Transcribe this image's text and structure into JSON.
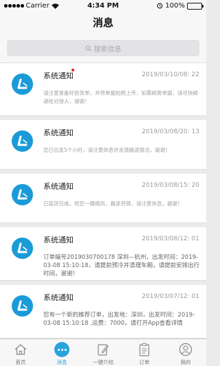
{
  "status_bar": {
    "carrier": "Carrier",
    "time": "4:34 PM",
    "battery": "100%"
  },
  "nav": {
    "title": "消息"
  },
  "search": {
    "placeholder": "搜索信息"
  },
  "messages": [
    {
      "title": "系统通知",
      "time": "2019/03/10/08: 22",
      "unread": true,
      "body": "请注意准备好验货单，并将单据拍照上传，如需邮寄单据，请尽快邮递给对接人，谢谢！"
    },
    {
      "title": "系统通知",
      "time": "2019/03/08/20: 13",
      "unread": false,
      "body": "您已出发5个小时，请注意休息并反馈路途情况，谢谢！"
    },
    {
      "title": "系统通知",
      "time": "2019/03/08/15: 20",
      "unread": false,
      "body": "已装货完成，祝您一路顺风，路途劳顿，请注意休息，谢谢！"
    },
    {
      "title": "系统通知",
      "time": "2019/03/08/12: 01",
      "unread": false,
      "body": "订单编号2019030700178 深圳—杭州，出发时间：2019-03-08 15:10:18，请提前预冷并清理车厢，请提前安排出行时间，谢谢！"
    },
    {
      "title": "系统通知",
      "time": "2019/03/07/12: 01",
      "unread": false,
      "body": "您有一个新的推荐订单，出发地：深圳，出发时间：2019-03-08 15:10:18 ,运费：7000，请打开App查看详情"
    }
  ],
  "tabs": [
    {
      "label": "首页",
      "icon": "home-icon",
      "active": false
    },
    {
      "label": "消息",
      "icon": "chat-icon",
      "active": true
    },
    {
      "label": "一键介绍",
      "icon": "edit-icon",
      "active": false
    },
    {
      "label": "订单",
      "icon": "clipboard-icon",
      "active": false
    },
    {
      "label": "我的",
      "icon": "user-icon",
      "active": false
    }
  ],
  "colors": {
    "accent": "#2aa3dc",
    "avatar": "#1a9bd8",
    "unread_dot": "#e2231a"
  }
}
